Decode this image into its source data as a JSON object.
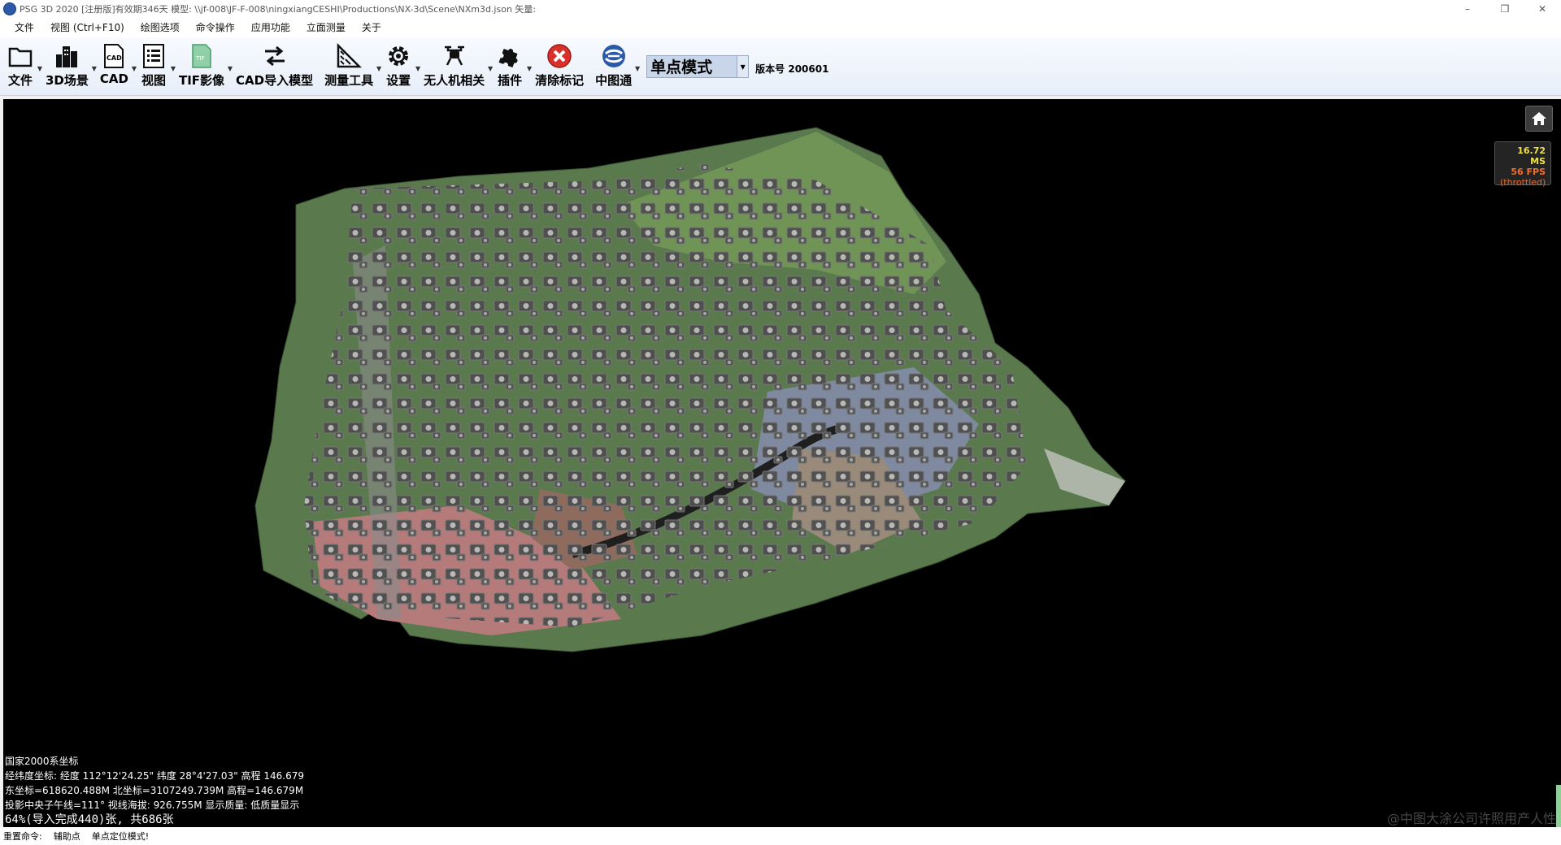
{
  "window": {
    "title": "PSG 3D 2020 [注册版]有效期346天 模型: \\\\jf-008\\JF-F-008\\ningxiangCESHI\\Productions\\NX-3d\\Scene\\NXm3d.json 矢量:",
    "minimize": "–",
    "restore": "❐",
    "close": "✕"
  },
  "menu": [
    "文件",
    "视图 (Ctrl+F10)",
    "绘图选项",
    "命令操作",
    "应用功能",
    "立面测量",
    "关于"
  ],
  "toolbar": {
    "file": "文件",
    "scene3d": "3D场景",
    "cad": "CAD",
    "view": "视图",
    "tif": "TIF影像",
    "cad_import": "CAD导入模型",
    "measure": "测量工具",
    "settings": "设置",
    "uav": "无人机相关",
    "plugins": "插件",
    "clear_marks": "清除标记",
    "zhongtutong": "中图通",
    "mode": "单点模式",
    "version": "版本号 200601"
  },
  "perf": {
    "ms": "16.72 MS",
    "fps": "56 FPS",
    "throttled": "(throttled)"
  },
  "info": {
    "crs": "国家2000系坐标",
    "geo": "经纬度坐标: 经度 112°12'24.25\" 纬度 28°4'27.03\" 高程 146.679",
    "proj": "东坐标=618620.488M 北坐标=3107249.739M 高程=146.679M",
    "meridian": "投影中央子午线=111° 视线海拔: 926.755M 显示质量: 低质量显示",
    "progress": "64%(导入完成440)张, 共686张"
  },
  "watermark": "@中图大涂公司许照用产人性",
  "status": {
    "command": "重置命令:",
    "aux": "辅助点",
    "mode_msg": "单点定位模式!"
  },
  "colors": {
    "viewport_bg": "#000000",
    "accent": "#2b5aa8",
    "clear_red": "#d9302b"
  }
}
